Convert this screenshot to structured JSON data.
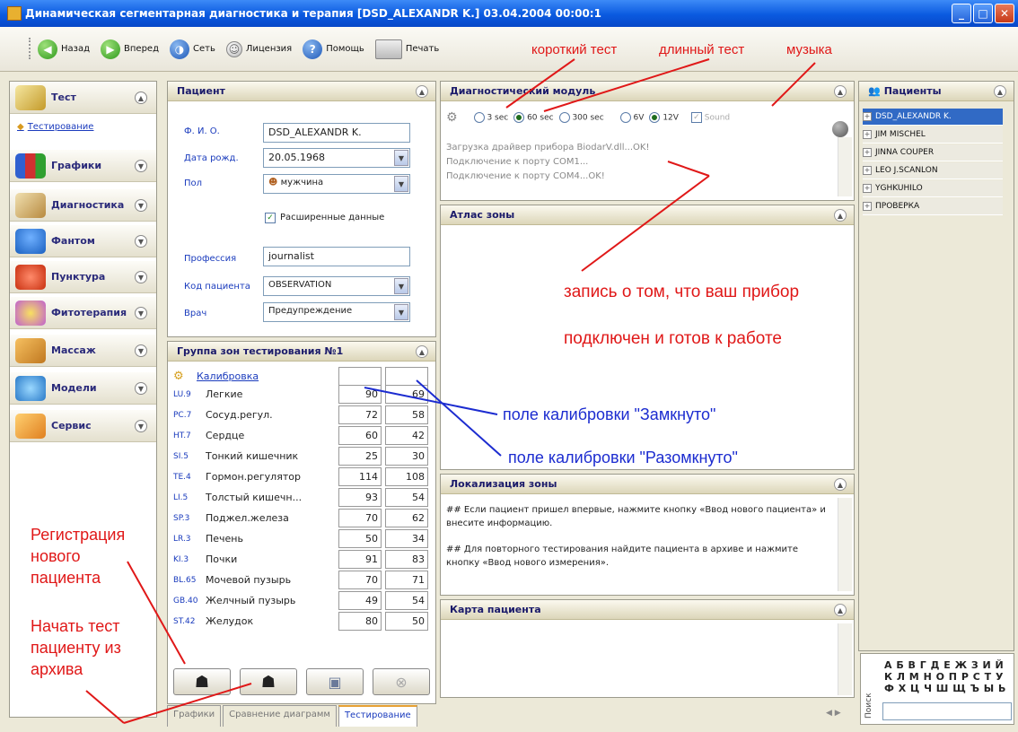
{
  "window": {
    "title": "Динамическая сегментарная диагностика и терапия [DSD_ALEXANDR K.] 03.04.2004 00:00:1"
  },
  "toolbar": {
    "back": "Назад",
    "forward": "Вперед",
    "network": "Сеть",
    "license": "Лицензия",
    "help": "Помощь",
    "print": "Печать"
  },
  "annotations": {
    "short_test": "короткий тест",
    "long_test": "длинный тест",
    "music": "музыка",
    "device_line1": "запись о том, что ваш прибор",
    "device_line2": "подключен и готов к работе",
    "closed_field": "поле калибровки \"Замкнуто\"",
    "open_field": "поле  калибровки \"Разомкнуто\"",
    "register": "Регистрация\nнового\nпациента",
    "start_test": "Начать тест\nпациенту из\nархива"
  },
  "sidebar": {
    "items": [
      {
        "label": "Тест",
        "sub": "Тестирование"
      },
      {
        "label": "Графики"
      },
      {
        "label": "Диагностика"
      },
      {
        "label": "Фантом"
      },
      {
        "label": "Пунктура"
      },
      {
        "label": "Фитотерапия"
      },
      {
        "label": "Массаж"
      },
      {
        "label": "Модели"
      },
      {
        "label": "Сервис"
      }
    ]
  },
  "patient": {
    "title": "Пациент",
    "fio_label": "Ф. И. О.",
    "fio": "DSD_ALEXANDR K.",
    "dob_label": "Дата рожд.",
    "dob": "20.05.1968",
    "sex_label": "Пол",
    "sex": "мужчина",
    "extended": "Расширенные данные",
    "profession_label": "Профессия",
    "profession": "journalist",
    "code_label": "Код пациента",
    "code": "OBSERVATION",
    "doctor_label": "Врач",
    "doctor": "Предупреждение"
  },
  "zones": {
    "title": "Группа зон тестирования №1",
    "calibration": "Калибровка",
    "rows": [
      {
        "code": "LU.9",
        "name": "Легкие",
        "v1": "90",
        "v2": "69"
      },
      {
        "code": "PC.7",
        "name": "Сосуд.регул.",
        "v1": "72",
        "v2": "58"
      },
      {
        "code": "HT.7",
        "name": "Сердце",
        "v1": "60",
        "v2": "42"
      },
      {
        "code": "SI.5",
        "name": "Тонкий кишечник",
        "v1": "25",
        "v2": "30"
      },
      {
        "code": "TE.4",
        "name": "Гормон.регулятор",
        "v1": "114",
        "v2": "108"
      },
      {
        "code": "LI.5",
        "name": "Толстый  кишечн...",
        "v1": "93",
        "v2": "54"
      },
      {
        "code": "SP.3",
        "name": "Поджел.железа",
        "v1": "70",
        "v2": "62"
      },
      {
        "code": "LR.3",
        "name": "Печень",
        "v1": "50",
        "v2": "34"
      },
      {
        "code": "KI.3",
        "name": "Почки",
        "v1": "91",
        "v2": "83"
      },
      {
        "code": "BL.65",
        "name": "Мочевой пузырь",
        "v1": "70",
        "v2": "71"
      },
      {
        "code": "GB.40",
        "name": "Желчный пузырь",
        "v1": "49",
        "v2": "54"
      },
      {
        "code": "ST.42",
        "name": "Желудок",
        "v1": "80",
        "v2": "50"
      }
    ]
  },
  "diag": {
    "title": "Диагностический модуль",
    "r3": "3 sec",
    "r60": "60 sec",
    "r300": "300 sec",
    "r6v": "6V",
    "r12v": "12V",
    "sound": "Sound",
    "log": [
      "Загрузка драйвер прибора BiodarV.dll...OK!",
      "Подключение к порту COM1...",
      "Подключение к порту COM4...OK!"
    ]
  },
  "atlas": {
    "title": "Атлас зоны"
  },
  "localization": {
    "title": "Локализация зоны",
    "text1": "## Если пациент пришел впервые, нажмите кнопку «Ввод нового пациента» и внесите информацию.",
    "text2": "## Для повторного тестирования найдите пациента в архиве и нажмите кнопку «Ввод нового измерения»."
  },
  "card": {
    "title": "Карта пациента"
  },
  "patients": {
    "title": "Пациенты",
    "list": [
      "DSD_ALEXANDR K.",
      "JIM MISCHEL",
      "JINNA COUPER",
      "LEO J.SCANLON",
      "YGHKUHILO",
      "ПРОВЕРКА"
    ]
  },
  "tabs": [
    "Графики",
    "Сравнение диаграмм",
    "Тестирование"
  ],
  "alphabet": {
    "row1": "А Б В Г Д Е Ж З И Й",
    "row2": "К Л М Н О П Р С Т У",
    "row3": "Ф Х Ц Ч Ш Щ Ъ Ы Ь",
    "search": "Поиск"
  },
  "colors": {
    "annotation_red": "#e01818",
    "annotation_blue": "#1c2cd0",
    "title_blue": "#0a5ae0"
  }
}
